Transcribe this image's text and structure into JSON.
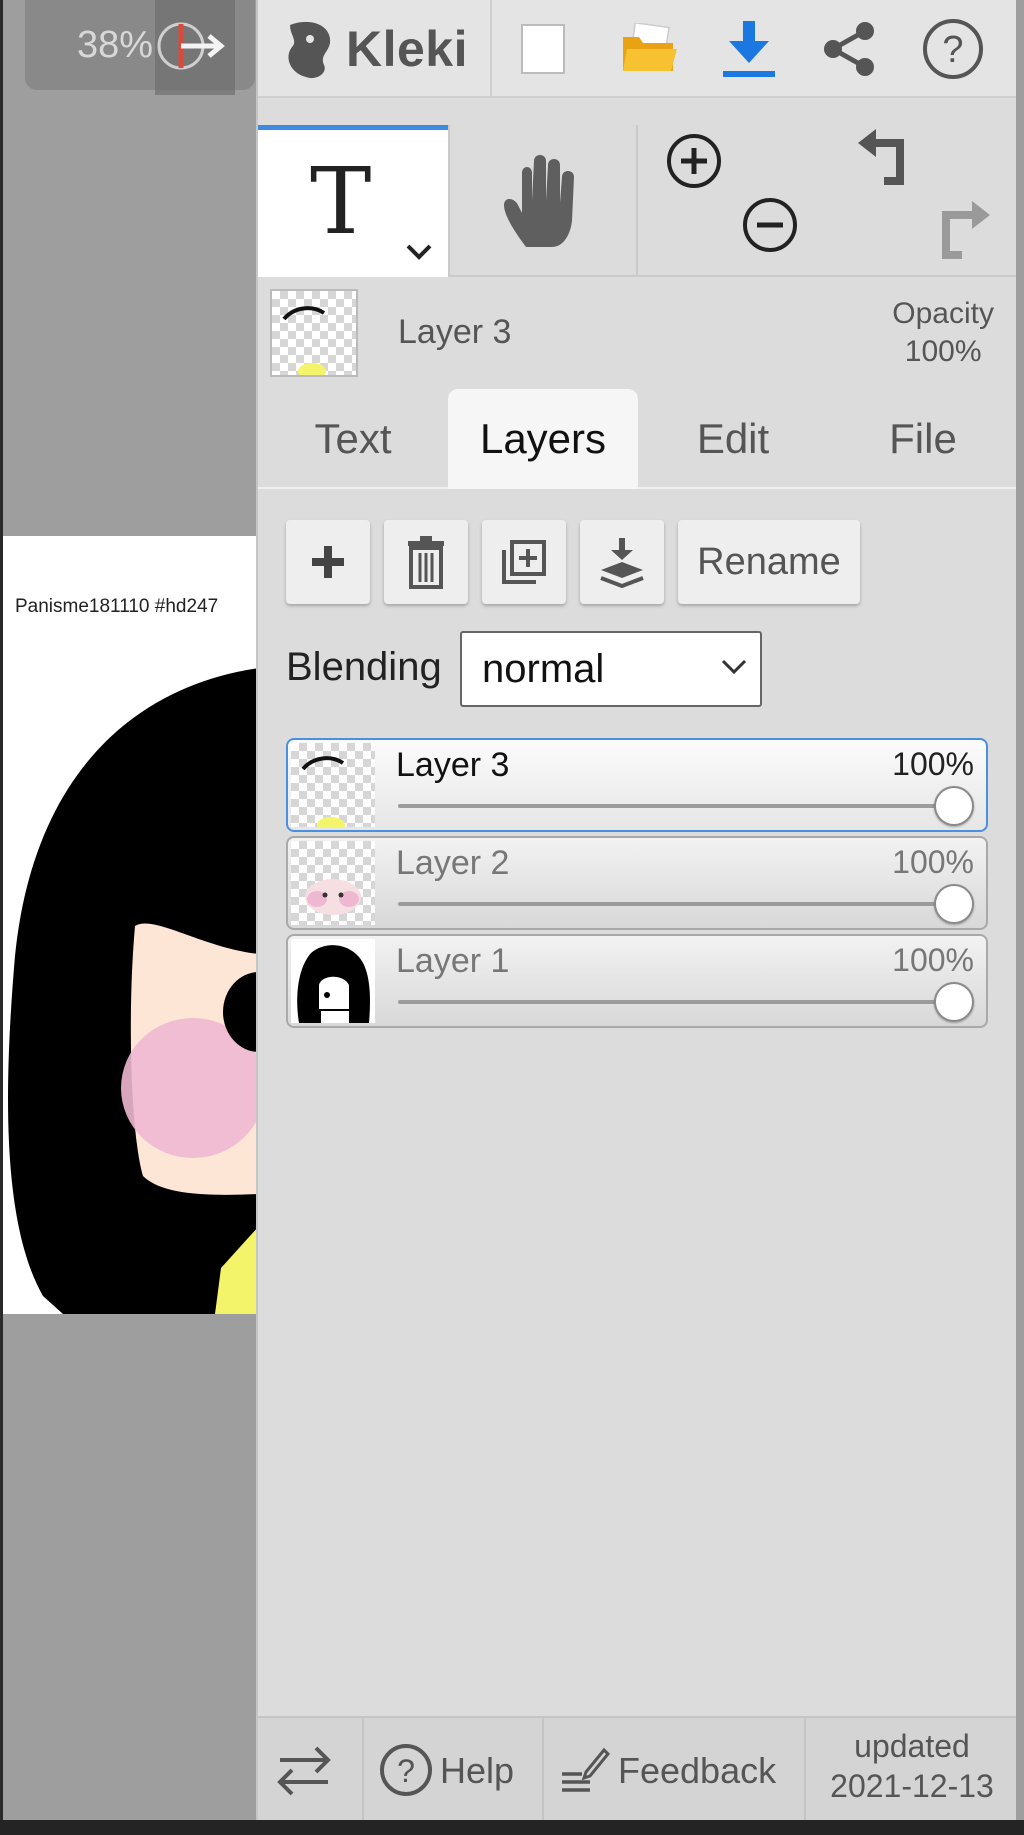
{
  "canvas": {
    "zoom": "38%",
    "caption": "Panisme181110 #hd247"
  },
  "topbar": {
    "brand": "Kleki",
    "icons": [
      "new-image-icon",
      "open-folder-icon",
      "download-icon",
      "share-icon",
      "help-icon"
    ],
    "colors": {
      "folder": "#f2b01e",
      "download": "#1a78e0"
    }
  },
  "tools": {
    "active": "text-tool",
    "text_glyph": "T"
  },
  "current_layer": {
    "name": "Layer 3",
    "opacity_label": "Opacity",
    "opacity_value": "100%"
  },
  "tabs": [
    {
      "label": "Text"
    },
    {
      "label": "Layers"
    },
    {
      "label": "Edit"
    },
    {
      "label": "File"
    }
  ],
  "active_tab": "Layers",
  "layer_buttons": {
    "rename": "Rename"
  },
  "blending": {
    "label": "Blending",
    "value": "normal"
  },
  "layers": [
    {
      "name": "Layer 3",
      "opacity": "100%",
      "opacity_fraction": 1.0,
      "selected": true
    },
    {
      "name": "Layer 2",
      "opacity": "100%",
      "opacity_fraction": 1.0,
      "selected": false
    },
    {
      "name": "Layer 1",
      "opacity": "100%",
      "opacity_fraction": 1.0,
      "selected": false
    }
  ],
  "footer": {
    "help": "Help",
    "feedback": "Feedback",
    "updated_label": "updated",
    "updated_date": "2021-12-13"
  },
  "accent_color": "#3b8be0"
}
